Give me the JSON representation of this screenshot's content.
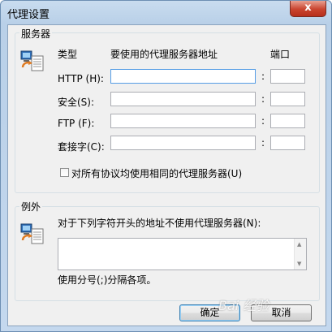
{
  "window": {
    "title": "代理设置",
    "close_glyph": "x"
  },
  "servers": {
    "group_label": "服务器",
    "col_type": "类型",
    "col_address": "要使用的代理服务器地址",
    "col_port": "端口",
    "rows": [
      {
        "label": "HTTP (H):",
        "address": "",
        "port": ""
      },
      {
        "label": "安全(S):",
        "address": "",
        "port": ""
      },
      {
        "label": "FTP (F):",
        "address": "",
        "port": ""
      },
      {
        "label": "套接字(C):",
        "address": "",
        "port": ""
      }
    ],
    "separator": ":",
    "same_proxy_label": "对所有协议均使用相同的代理服务器(U)"
  },
  "exceptions": {
    "group_label": "例外",
    "description": "对于下列字符开头的地址不使用代理服务器(N):",
    "value": "",
    "hint": "使用分号(;)分隔各项。"
  },
  "buttons": {
    "ok": "确定",
    "cancel": "取消"
  },
  "watermark": "Bai 经验",
  "icons": {
    "servers": "network-computer-icon",
    "exceptions": "network-computer-icon"
  }
}
